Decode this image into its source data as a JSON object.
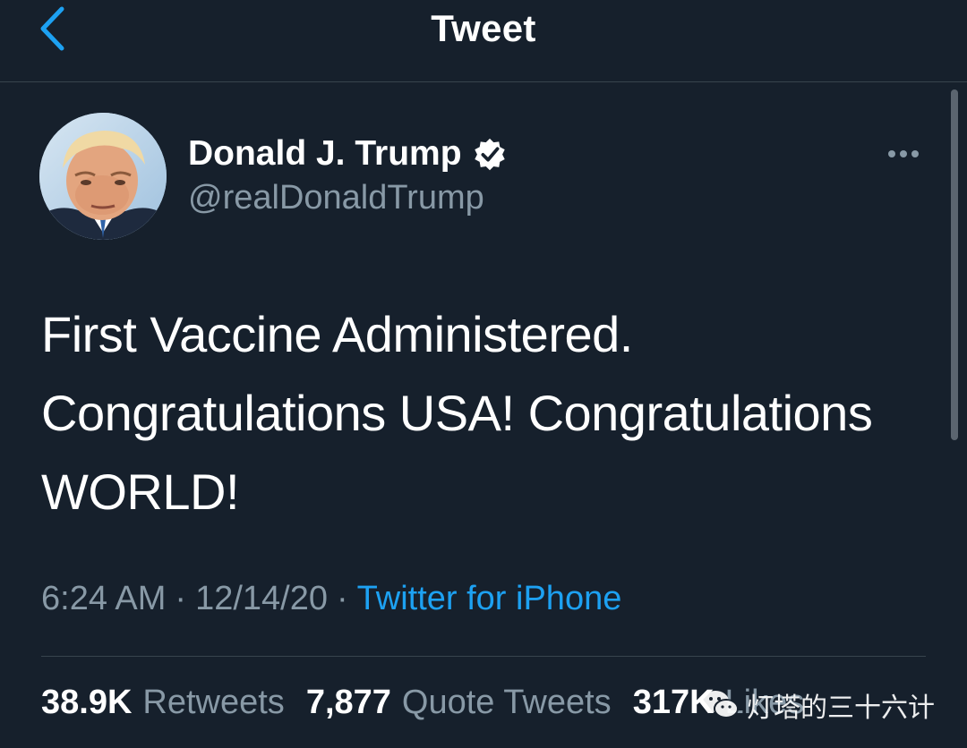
{
  "header": {
    "title": "Tweet",
    "back_icon": "chevron-left-icon"
  },
  "author": {
    "display_name": "Donald J. Trump",
    "handle": "@realDonaldTrump",
    "verified": true
  },
  "tweet": {
    "text": "First Vaccine Administered. Congratulations USA! Congratulations WORLD!",
    "time": "6:24 AM",
    "separator": "·",
    "date": "12/14/20",
    "source": "Twitter for iPhone"
  },
  "stats": {
    "retweets": {
      "count": "38.9K",
      "label": "Retweets"
    },
    "quote_tweets": {
      "count": "7,877",
      "label": "Quote Tweets"
    },
    "likes": {
      "count": "317K",
      "label": "Likes"
    }
  },
  "watermark": {
    "text": "灯塔的三十六计"
  },
  "colors": {
    "background": "#16202c",
    "accent": "#1da1f2",
    "secondary_text": "#8899a6",
    "divider": "#38444d"
  }
}
